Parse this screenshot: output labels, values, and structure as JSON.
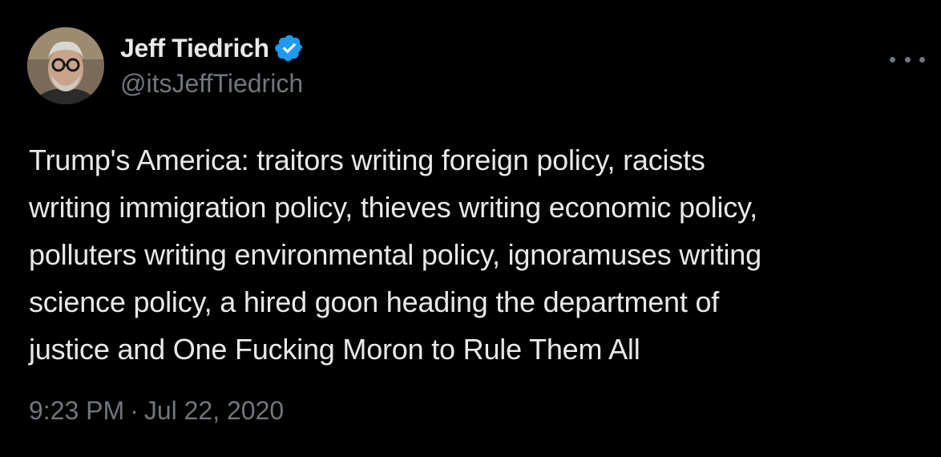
{
  "author": {
    "display_name": "Jeff Tiedrich",
    "handle": "@itsJeffTiedrich",
    "verified": true,
    "avatar_icon": "user-avatar-photo"
  },
  "more_icon": "more-horizontal-icon",
  "verified_color": "#1d9bf0",
  "tweet": {
    "lines": [
      "Trump's America: traitors writing foreign policy, racists",
      "writing immigration policy, thieves writing economic policy,",
      "polluters writing environmental policy, ignoramuses writing",
      "science policy, a hired goon heading the department of",
      "justice and One Fucking Moron to Rule Them All"
    ],
    "time": "9:23 PM",
    "separator": "·",
    "date": "Jul 22, 2020"
  }
}
